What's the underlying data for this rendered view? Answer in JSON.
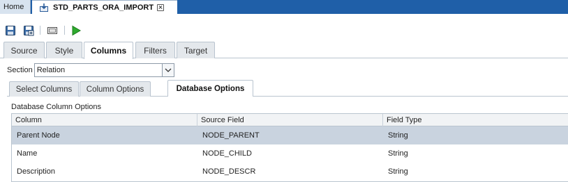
{
  "doc_tabs": {
    "home_label": "Home",
    "active_label": "STD_PARTS_ORA_IMPORT"
  },
  "toolbar": {
    "icons": [
      "save-icon",
      "save-as-icon",
      "preview-icon",
      "run-icon"
    ]
  },
  "main_tabs": [
    {
      "label": "Source",
      "active": false
    },
    {
      "label": "Style",
      "active": false
    },
    {
      "label": "Columns",
      "active": true
    },
    {
      "label": "Filters",
      "active": false
    },
    {
      "label": "Target",
      "active": false
    }
  ],
  "section": {
    "label": "Section",
    "value": "Relation"
  },
  "sub_tabs": [
    {
      "label": "Select Columns",
      "active": false
    },
    {
      "label": "Column Options",
      "active": false
    },
    {
      "label": "Database Options",
      "active": true
    }
  ],
  "group_title": "Database Column Options",
  "table": {
    "headers": [
      "Column",
      "Source Field",
      "Field Type"
    ],
    "rows": [
      [
        "Parent Node",
        "NODE_PARENT",
        "String"
      ],
      [
        "Name",
        "NODE_CHILD",
        "String"
      ],
      [
        "Description",
        "NODE_DESCR",
        "String"
      ]
    ]
  },
  "colors": {
    "tab_bar": "#1f5fa8",
    "selected_row": "#c9d3df",
    "run_icon": "#2eaa2e"
  }
}
